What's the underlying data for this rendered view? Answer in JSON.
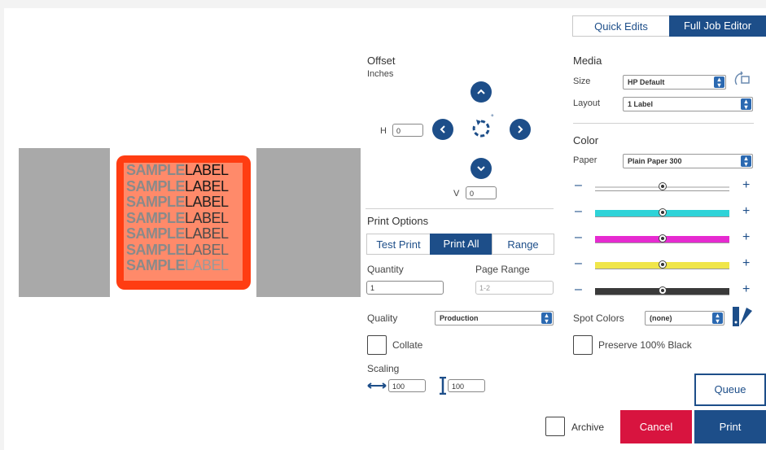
{
  "tabs": {
    "quick_edits": "Quick Edits",
    "full_job_editor": "Full Job Editor"
  },
  "preview": {
    "rows": [
      {
        "a": "SAMPLE",
        "b": "LABEL",
        "b_color": "#111111"
      },
      {
        "a": "SAMPLE",
        "b": "LABEL",
        "b_color": "#1a1a1a"
      },
      {
        "a": "SAMPLE",
        "b": "LABEL",
        "b_color": "#222222"
      },
      {
        "a": "SAMPLE",
        "b": "LABEL",
        "b_color": "#333333"
      },
      {
        "a": "SAMPLE",
        "b": "LABEL",
        "b_color": "#4a4a4a"
      },
      {
        "a": "SAMPLE",
        "b": "LABEL",
        "b_color": "#6a6a6a"
      },
      {
        "a": "SAMPLE",
        "b": "LABEL",
        "b_color": "#9a9a9a"
      }
    ]
  },
  "offset": {
    "title": "Offset",
    "units": "Inches",
    "h_label": "H",
    "h_value": "0",
    "v_label": "V",
    "v_value": "0",
    "rotation_degree": "°"
  },
  "print_options": {
    "title": "Print Options",
    "segments": [
      "Test Print",
      "Print All",
      "Range"
    ],
    "active_segment": "Print All",
    "quantity_label": "Quantity",
    "quantity_value": "1",
    "page_range_label": "Page Range",
    "page_range_placeholder": "1-2",
    "quality_label": "Quality",
    "quality_value": "Production",
    "collate_label": "Collate",
    "scaling_label": "Scaling",
    "scale_h": "100",
    "scale_v": "100"
  },
  "media": {
    "title": "Media",
    "size_label": "Size",
    "size_value": "HP Default",
    "layout_label": "Layout",
    "layout_value": "1 Label"
  },
  "color": {
    "title": "Color",
    "paper_label": "Paper",
    "paper_value": "Plain Paper 300",
    "sliders": [
      {
        "name": "overall",
        "color": "#d8d8d8",
        "level": 0.5
      },
      {
        "name": "cyan",
        "color": "#2fd3d8",
        "level": 0.5
      },
      {
        "name": "magenta",
        "color": "#e62ad0",
        "level": 0.5
      },
      {
        "name": "yellow",
        "color": "#f0e64a",
        "level": 0.5
      },
      {
        "name": "black",
        "color": "#3a3a3a",
        "level": 0.5
      }
    ],
    "minus": "–",
    "plus": "+",
    "spot_colors_label": "Spot Colors",
    "spot_colors_value": "(none)",
    "preserve_black_label": "Preserve 100% Black"
  },
  "actions": {
    "queue": "Queue",
    "archive": "Archive",
    "cancel": "Cancel",
    "print": "Print"
  },
  "colors": {
    "primary": "#1d4e89",
    "cancel": "#d8143f",
    "label_bg": "#ff3d12"
  }
}
